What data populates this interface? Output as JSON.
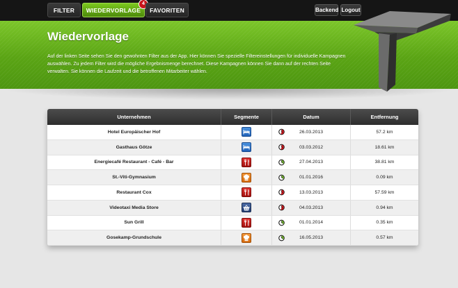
{
  "nav": {
    "tabs": [
      {
        "label": "FILTER"
      },
      {
        "label": "WIEDERVORLAGE",
        "badge": "4",
        "active": true
      },
      {
        "label": "FAVORITEN"
      }
    ],
    "backend_label": "Backend",
    "logout_label": "Logout"
  },
  "hero": {
    "title": "Wiedervorlage",
    "text": "Auf der linken Seite sehen Sie den gewohnten Filter aus der App. Hier können Sie spezielle Filtereinstellungen für individuelle Kampagnen auswählen. Zu jedem Filter wird die mögliche Ergebnismenge berechnet. Diese Kampagnen können Sie dann auf der rechten Seite verwalten. Sie können die Laufzeit und die betroffenen Mitarbeiter wählen."
  },
  "table": {
    "headers": [
      "Unternehmen",
      "Segmente",
      "Datum",
      "Entfernung"
    ],
    "rows": [
      {
        "name": "Hotel Europäischer Hof",
        "segment_icon": "bed-icon",
        "segment_color": "#2f76c9",
        "clock": "red",
        "date": "26.03.2013",
        "distance": "57.2 km"
      },
      {
        "name": "Gasthaus Götze",
        "segment_icon": "bed-icon",
        "segment_color": "#2f76c9",
        "clock": "red",
        "date": "03.03.2012",
        "distance": "18.61 km"
      },
      {
        "name": "Energiecafé Restaurant - Café - Bar",
        "segment_icon": "cutlery-icon",
        "segment_color": "#c21b18",
        "clock": "green",
        "date": "27.04.2013",
        "distance": "38.81 km"
      },
      {
        "name": "St.-Viti-Gymnasium",
        "segment_icon": "chef-hat-icon",
        "segment_color": "#e77f22",
        "clock": "green",
        "date": "01.01.2016",
        "distance": "0.09 km"
      },
      {
        "name": "Restaurant Cox",
        "segment_icon": "cutlery-icon",
        "segment_color": "#c21b18",
        "clock": "red",
        "date": "13.03.2013",
        "distance": "57.59 km"
      },
      {
        "name": "Videotaxi Media Store",
        "segment_icon": "basket-icon",
        "segment_color": "#34538f",
        "clock": "red",
        "date": "04.03.2013",
        "distance": "0.94 km"
      },
      {
        "name": "Sun Grill",
        "segment_icon": "cutlery-icon",
        "segment_color": "#c21b18",
        "clock": "green",
        "date": "01.01.2014",
        "distance": "0.35 km"
      },
      {
        "name": "Gosekamp-Grundschule",
        "segment_icon": "chef-hat-icon",
        "segment_color": "#e77f22",
        "clock": "green",
        "date": "16.05.2013",
        "distance": "0.57 km"
      }
    ]
  }
}
